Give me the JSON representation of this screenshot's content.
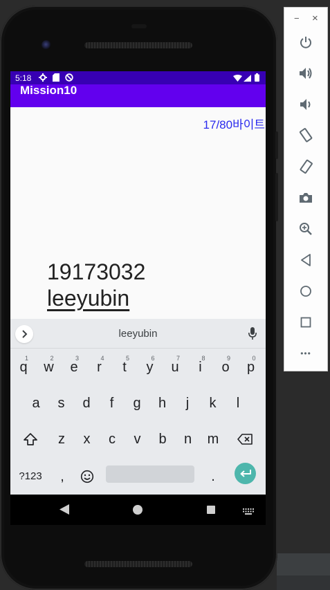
{
  "status_bar": {
    "time": "5:18"
  },
  "app": {
    "title": "Mission10"
  },
  "content": {
    "byte_counter": "17/80바이트",
    "input_line1": "19173032",
    "input_line2": "leeyubin"
  },
  "keyboard": {
    "suggestion": "leeyubin",
    "row1": [
      {
        "k": "q",
        "h": "1"
      },
      {
        "k": "w",
        "h": "2"
      },
      {
        "k": "e",
        "h": "3"
      },
      {
        "k": "r",
        "h": "4"
      },
      {
        "k": "t",
        "h": "5"
      },
      {
        "k": "y",
        "h": "6"
      },
      {
        "k": "u",
        "h": "7"
      },
      {
        "k": "i",
        "h": "8"
      },
      {
        "k": "o",
        "h": "9"
      },
      {
        "k": "p",
        "h": "0"
      }
    ],
    "row2": [
      "a",
      "s",
      "d",
      "f",
      "g",
      "h",
      "j",
      "k",
      "l"
    ],
    "row3": [
      "z",
      "x",
      "c",
      "v",
      "b",
      "n",
      "m"
    ],
    "symbols_key": "?123",
    "comma_key": ",",
    "period_key": "."
  },
  "emulator_toolbar": {
    "minimize": "−",
    "close": "×",
    "more": "•••"
  },
  "colors": {
    "status_bar": "#3700b3",
    "action_bar": "#6200ee",
    "counter_text": "#2a2aee",
    "enter_key": "#4db6ac"
  }
}
